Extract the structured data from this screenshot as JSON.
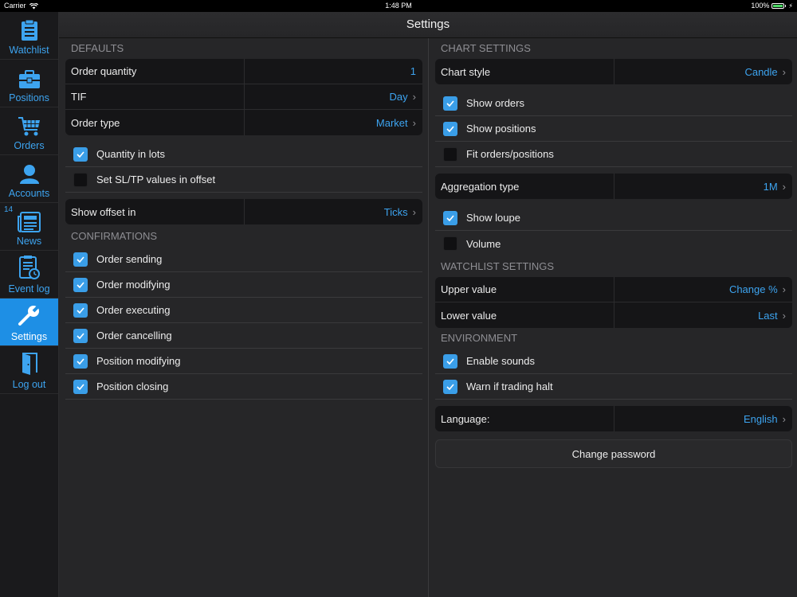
{
  "status_bar": {
    "carrier": "Carrier",
    "time": "1:48 PM",
    "battery": "100%"
  },
  "sidebar": {
    "items": [
      {
        "label": "Watchlist",
        "icon": "watchlist-icon"
      },
      {
        "label": "Positions",
        "icon": "briefcase-icon"
      },
      {
        "label": "Orders",
        "icon": "cart-icon"
      },
      {
        "label": "Accounts",
        "icon": "person-icon"
      },
      {
        "label": "News",
        "icon": "news-icon",
        "badge": "14"
      },
      {
        "label": "Event log",
        "icon": "event-log-icon"
      },
      {
        "label": "Settings",
        "icon": "wrench-icon",
        "active": true
      },
      {
        "label": "Log out",
        "icon": "door-exit-icon"
      }
    ]
  },
  "header": {
    "title": "Settings"
  },
  "left": {
    "defaults_title": "DEFAULTS",
    "defaults": [
      {
        "label": "Order quantity",
        "value": "1"
      },
      {
        "label": "TIF",
        "value": "Day"
      },
      {
        "label": "Order type",
        "value": "Market"
      }
    ],
    "checks1": [
      {
        "label": "Quantity in lots",
        "checked": true
      },
      {
        "label": "Set SL/TP values in offset",
        "checked": false
      }
    ],
    "offset": {
      "label": "Show offset in",
      "value": "Ticks"
    },
    "confirmations_title": "CONFIRMATIONS",
    "confirmations": [
      {
        "label": "Order sending",
        "checked": true
      },
      {
        "label": "Order modifying",
        "checked": true
      },
      {
        "label": "Order executing",
        "checked": true
      },
      {
        "label": "Order cancelling",
        "checked": true
      },
      {
        "label": "Position modifying",
        "checked": true
      },
      {
        "label": "Position closing",
        "checked": true
      }
    ]
  },
  "right": {
    "chart_title": "CHART SETTINGS",
    "chart_style": {
      "label": "Chart style",
      "value": "Candle"
    },
    "chart_checks": [
      {
        "label": "Show orders",
        "checked": true
      },
      {
        "label": "Show positions",
        "checked": true
      },
      {
        "label": "Fit orders/positions",
        "checked": false
      }
    ],
    "aggregation": {
      "label": "Aggregation type",
      "value": "1M"
    },
    "agg_checks": [
      {
        "label": "Show loupe",
        "checked": true
      },
      {
        "label": "Volume",
        "checked": false
      }
    ],
    "watchlist_title": "WATCHLIST SETTINGS",
    "watchlist": [
      {
        "label": "Upper value",
        "value": "Change %"
      },
      {
        "label": "Lower value",
        "value": "Last"
      }
    ],
    "env_title": "ENVIRONMENT",
    "env_checks": [
      {
        "label": "Enable sounds",
        "checked": true
      },
      {
        "label": "Warn if trading halt",
        "checked": true
      }
    ],
    "language": {
      "label": "Language:",
      "value": "English"
    },
    "change_password": "Change password"
  },
  "colors": {
    "accent": "#3da4f0",
    "active_tab": "#1e8fe5",
    "checkbox_on": "#3a9ee8"
  }
}
